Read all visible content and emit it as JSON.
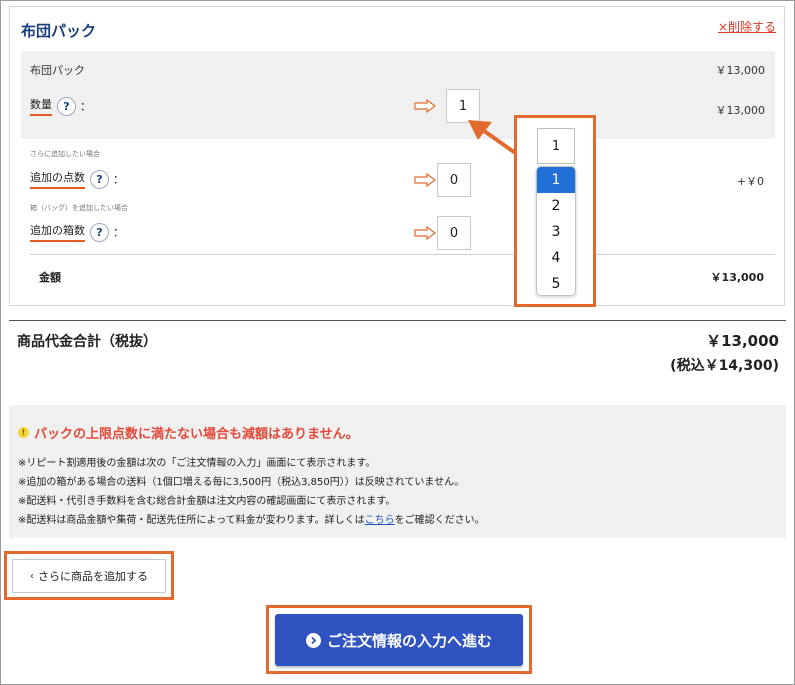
{
  "card": {
    "title": "布団パック",
    "delete_label": "×削除する",
    "pack_name": "布団パック",
    "pack_price": "￥13,000",
    "qty_label": "数量",
    "qty_value": "1",
    "qty_price": "￥13,000",
    "add_points_note": "さらに追加したい場合",
    "add_points_label": "追加の点数",
    "add_points_value": "0",
    "add_points_price": "+￥0",
    "add_box_note": "箱（バッグ）を追加したい場合",
    "add_box_label": "追加の箱数",
    "add_box_value": "0",
    "amount_label": "金額",
    "amount_value": "￥13,000",
    "help_glyph": "?",
    "colon": "："
  },
  "dropdown": {
    "selected": "1",
    "options": [
      "1",
      "2",
      "3",
      "4",
      "5"
    ]
  },
  "total": {
    "label": "商品代金合計（税抜）",
    "value": "￥13,000",
    "tax_included": "(税込￥14,300)"
  },
  "notice": {
    "warn_glyph": "!",
    "headline": "パックの上限点数に満たない場合も減額はありません。",
    "line1": "※リピート割適用後の金額は次の「ご注文情報の入力」画面にて表示されます。",
    "line2": "※追加の箱がある場合の送料（1個口増える毎に3,500円（税込3,850円））は反映されていません。",
    "line3": "※配送料・代引き手数料を含む総合計金額は注文内容の確認画面にて表示されます。",
    "line4_pre": "※配送料は商品金額や集荷・配送先住所によって料金が変わります。詳しくは",
    "line4_link": "こちら",
    "line4_post": "をご確認ください。"
  },
  "buttons": {
    "add_more_chev": "‹",
    "add_more": "さらに商品を追加する",
    "proceed": "ご注文情報の入力へ進む"
  },
  "colors": {
    "highlight": "#e26a2c",
    "primary": "#2f53c1",
    "title": "#1a3f7a",
    "warning_text": "#e24b3a",
    "selected_option": "#1f6fd6"
  }
}
